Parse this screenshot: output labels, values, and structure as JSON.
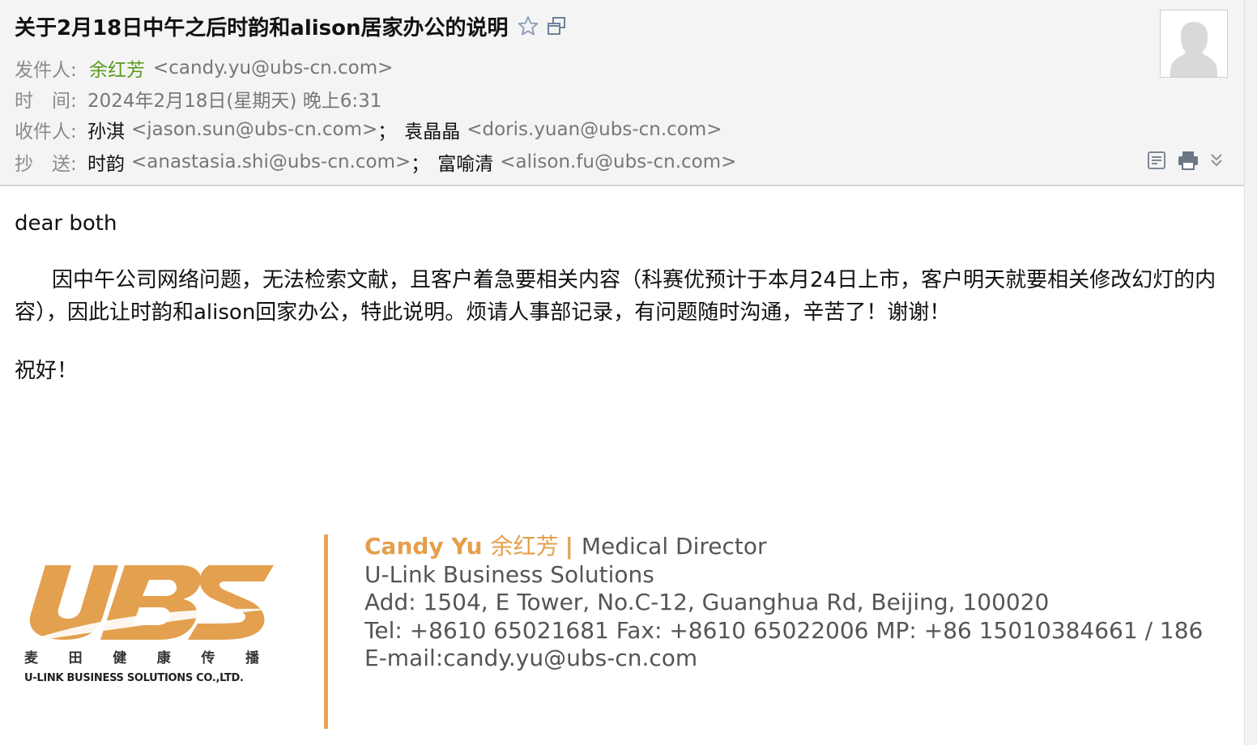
{
  "email": {
    "subject": "关于2月18日中午之后时韵和alison居家办公的说明",
    "labels": {
      "from": "发件人:",
      "time": "时　间:",
      "to": "收件人:",
      "cc": "抄　送:"
    },
    "from": {
      "name": "余红芳",
      "address": "<candy.yu@ubs-cn.com>"
    },
    "date": "2024年2月18日(星期天) 晚上6:31",
    "to": [
      {
        "name": "孙淇",
        "address": "<jason.sun@ubs-cn.com>"
      },
      {
        "name": "袁晶晶",
        "address": "<doris.yuan@ubs-cn.com>"
      }
    ],
    "cc": [
      {
        "name": "时韵",
        "address": "<anastasia.shi@ubs-cn.com>"
      },
      {
        "name": "富喻清",
        "address": "<alison.fu@ubs-cn.com>"
      }
    ],
    "separator": "；"
  },
  "icons": {
    "star": "star-outline-icon",
    "new_window": "new-window-icon",
    "note": "note-icon",
    "print": "printer-icon",
    "expand": "double-chevron-down-icon"
  },
  "body": {
    "greeting": "dear both",
    "paragraph": "因中午公司网络问题，无法检索文献，且客户着急要相关内容（科赛优预计于本月24日上市，客户明天就要相关修改幻灯的内容），因此让时韵和alison回家办公，特此说明。烦请人事部记录，有问题随时沟通，辛苦了！谢谢！",
    "closing": "祝好！"
  },
  "signature": {
    "logo": {
      "text": "UBS",
      "cn_characters": [
        "麦",
        "田",
        "健",
        "康",
        "传",
        "播"
      ],
      "en_text": "U-LINK BUSINESS SOLUTIONS CO.,LTD."
    },
    "name": "Candy Yu",
    "name_cn": "余红芳",
    "bar": "|",
    "title": "Medical Director",
    "company": "U-Link Business Solutions",
    "address": "Add: 1504, E Tower, No.C-12, Guanghua Rd, Beijing, 100020",
    "phones": "Tel: +8610 65021681  Fax: +8610 65022006  MP: +86 15010384661 / 186",
    "email": "E-mail:candy.yu@ubs-cn.com"
  },
  "colors": {
    "sender_green": "#5a9a1e",
    "brand_orange": "#e59f4c",
    "header_bg": "#f4f4f4"
  }
}
